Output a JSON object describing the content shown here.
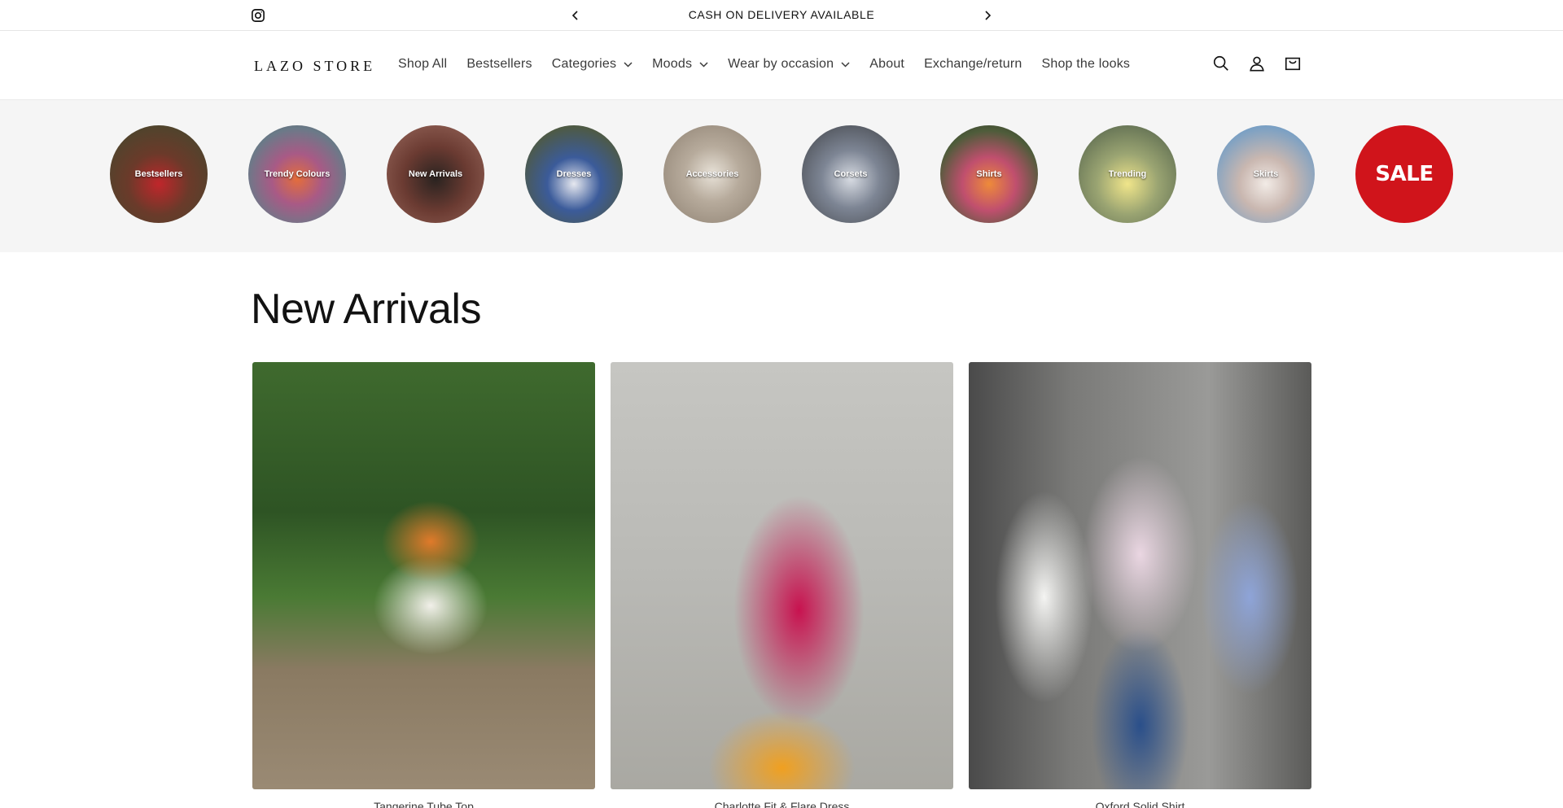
{
  "announcement": {
    "message": "CASH ON DELIVERY AVAILABLE",
    "icons": {
      "social": "instagram-icon",
      "prev": "chevron-left-icon",
      "next": "chevron-right-icon"
    }
  },
  "header": {
    "logo": "LAZO STORE",
    "nav": [
      {
        "label": "Shop All",
        "dropdown": false
      },
      {
        "label": "Bestsellers",
        "dropdown": false
      },
      {
        "label": "Categories",
        "dropdown": true
      },
      {
        "label": "Moods",
        "dropdown": true
      },
      {
        "label": "Wear by occasion",
        "dropdown": true
      },
      {
        "label": "About",
        "dropdown": false
      },
      {
        "label": "Exchange/return",
        "dropdown": false
      },
      {
        "label": "Shop the looks",
        "dropdown": false
      }
    ],
    "icons": [
      "search-icon",
      "account-icon",
      "cart-icon"
    ]
  },
  "categories": [
    {
      "label": "Bestsellers"
    },
    {
      "label": "Trendy Colours"
    },
    {
      "label": "New Arrivals"
    },
    {
      "label": "Dresses"
    },
    {
      "label": "Accessories"
    },
    {
      "label": "Corsets"
    },
    {
      "label": "Shirts"
    },
    {
      "label": "Trending"
    },
    {
      "label": "Skirts"
    },
    {
      "label": "SALE"
    }
  ],
  "new_arrivals": {
    "title": "New Arrivals",
    "products": [
      {
        "title": "Tangerine Tube Top"
      },
      {
        "title": "Charlotte Fit & Flare Dress"
      },
      {
        "title": "Oxford Solid Shirt"
      }
    ]
  },
  "colors": {
    "sale_red": "#d0141b",
    "band_bg": "#f5f5f5",
    "text": "#121212"
  }
}
